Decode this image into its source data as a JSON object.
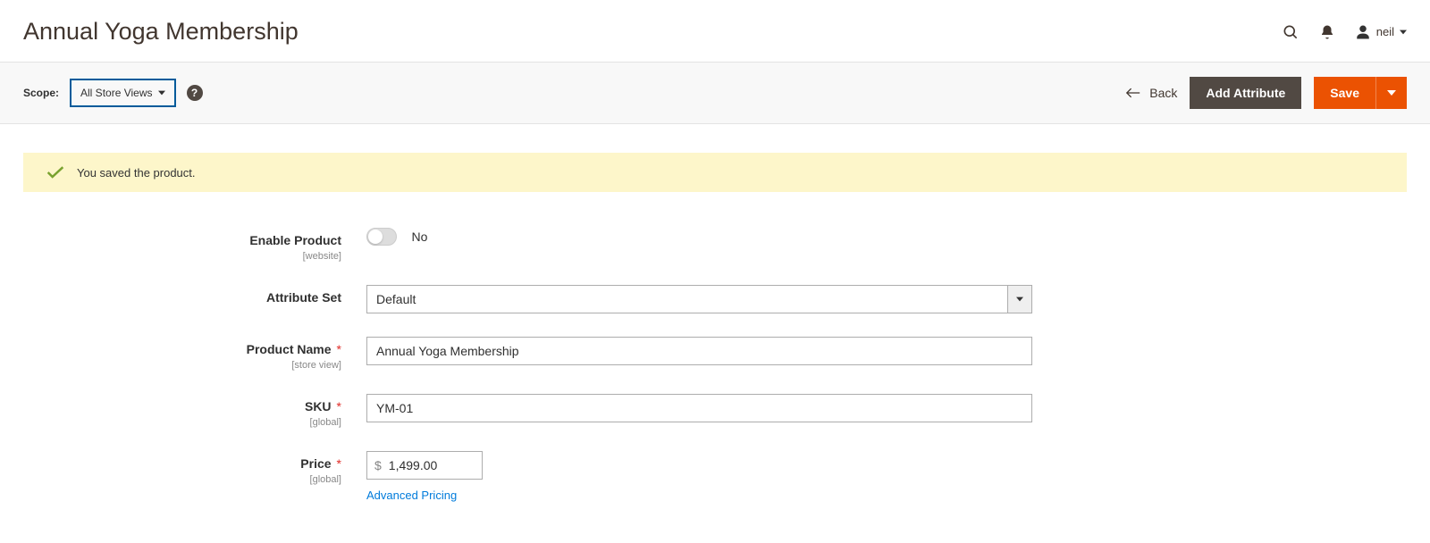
{
  "page": {
    "title": "Annual Yoga Membership",
    "user": "neil"
  },
  "toolbar": {
    "scope_label": "Scope:",
    "scope_value": "All Store Views",
    "back_label": "Back",
    "add_attribute_label": "Add Attribute",
    "save_label": "Save"
  },
  "message": {
    "text": "You saved the product."
  },
  "form": {
    "enable_product": {
      "label": "Enable Product",
      "hint": "[website]",
      "value": "No"
    },
    "attribute_set": {
      "label": "Attribute Set",
      "value": "Default"
    },
    "product_name": {
      "label": "Product Name",
      "hint": "[store view]",
      "value": "Annual Yoga Membership"
    },
    "sku": {
      "label": "SKU",
      "hint": "[global]",
      "value": "YM-01"
    },
    "price": {
      "label": "Price",
      "hint": "[global]",
      "currency": "$",
      "value": "1,499.00",
      "advanced_link": "Advanced Pricing"
    }
  }
}
